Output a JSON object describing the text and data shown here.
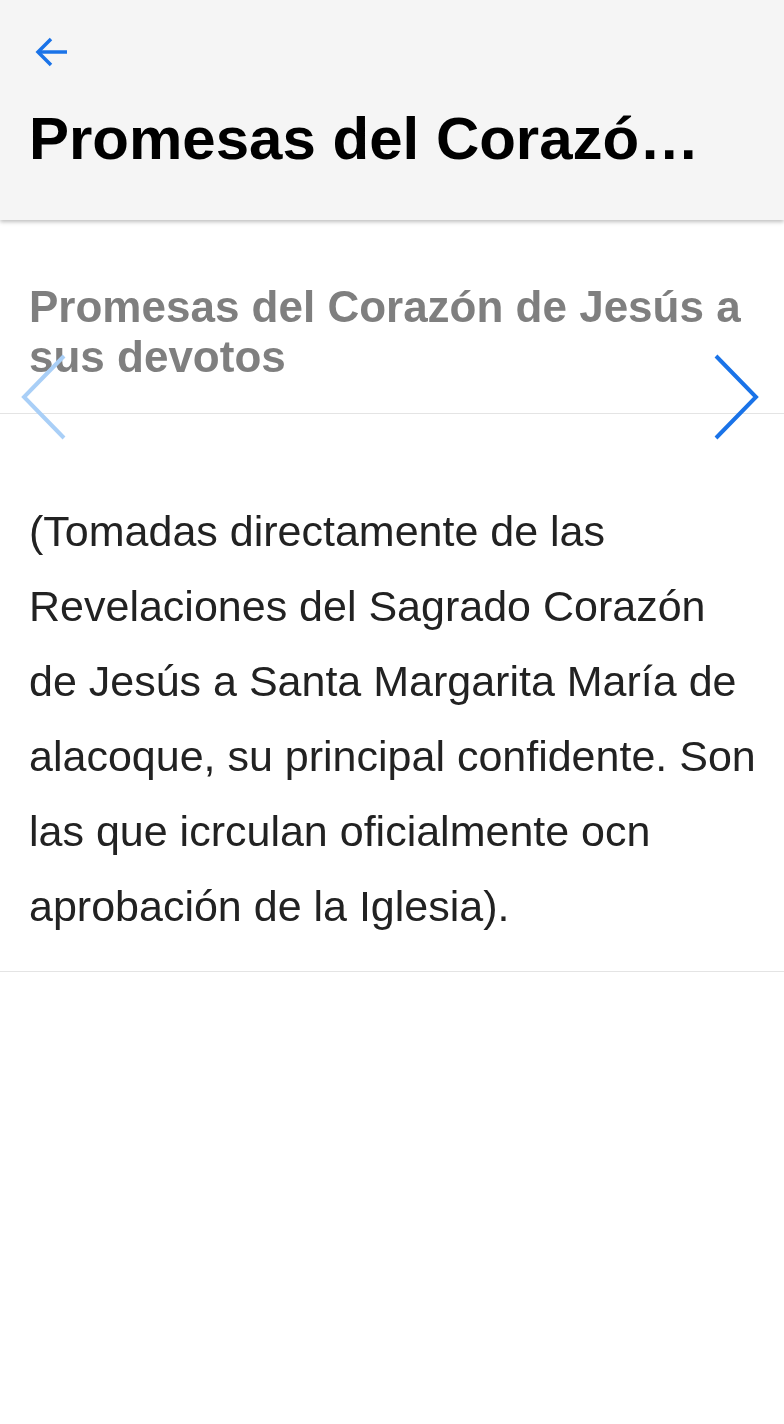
{
  "app_bar": {
    "title": "Promesas del Corazó…"
  },
  "header": {
    "title": "Promesas del Corazón de Jesús a sus devotos"
  },
  "nav": {
    "prev": {
      "disabled": true
    },
    "next": {
      "disabled": false
    }
  },
  "body": {
    "text": "(Tomadas directamente de las Revelaciones del Sagrado Corazón de Jesús a Santa Margarita María de alacoque, su principal confidente. Son las que icrculan oficialmente ocn aprobación de la Iglesia)."
  }
}
